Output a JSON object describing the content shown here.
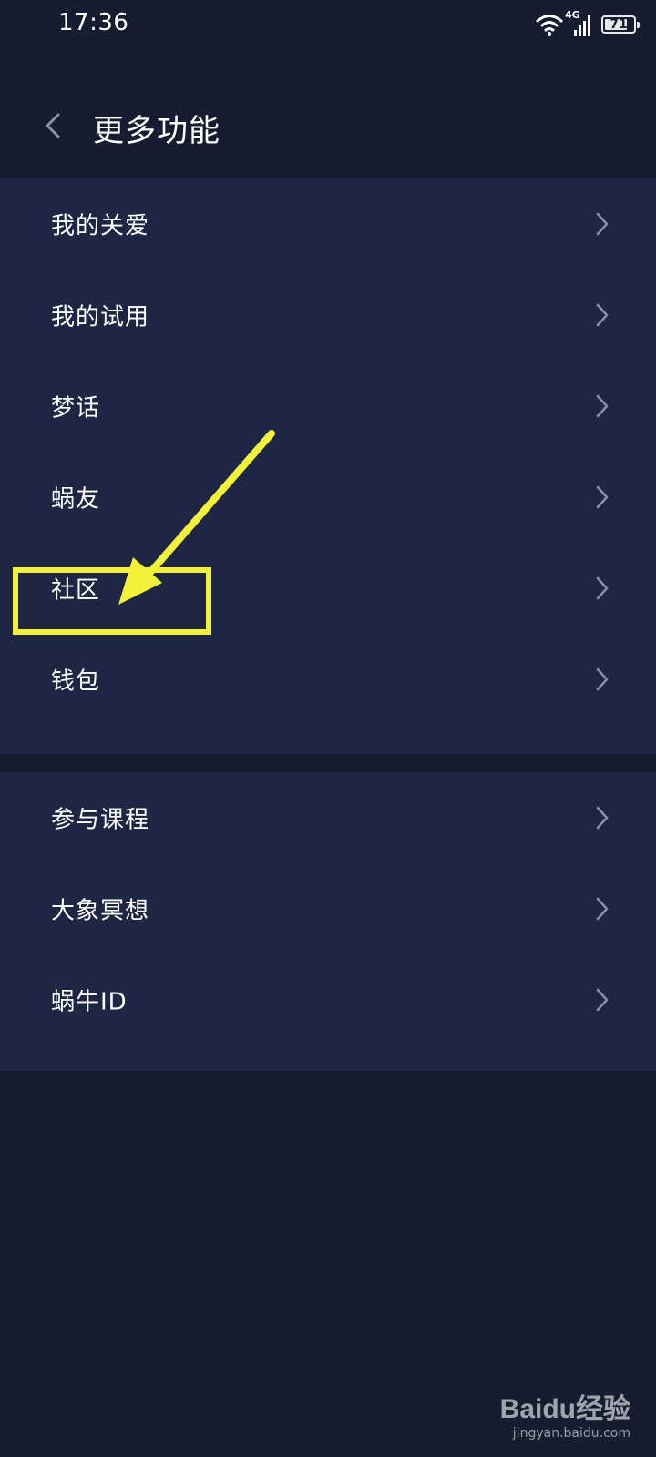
{
  "status_bar": {
    "time": "17:36",
    "network": "4G",
    "battery": "71"
  },
  "header": {
    "title": "更多功能"
  },
  "section_1": {
    "items": [
      {
        "label": "我的关爱"
      },
      {
        "label": "我的试用"
      },
      {
        "label": "梦话"
      },
      {
        "label": "蜗友"
      },
      {
        "label": "社区"
      },
      {
        "label": "钱包"
      }
    ]
  },
  "section_2": {
    "items": [
      {
        "label": "参与课程"
      },
      {
        "label": "大象冥想"
      },
      {
        "label": "蜗牛ID"
      }
    ]
  },
  "watermark": {
    "logo": "Baidu经验",
    "url": "jingyan.baidu.com"
  },
  "colors": {
    "background": "#181c31",
    "section": "#1f2644",
    "annotation": "#f1f239",
    "chevron": "#8a90a8"
  }
}
